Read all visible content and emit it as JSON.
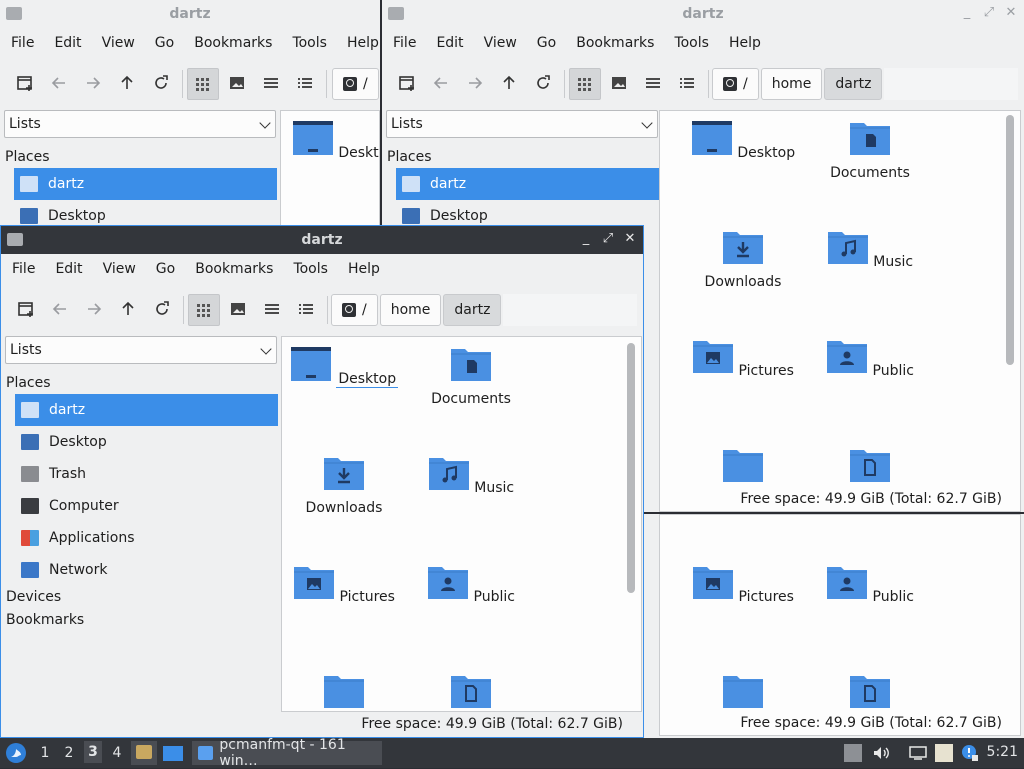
{
  "window": {
    "title": "dartz",
    "menu": [
      "File",
      "Edit",
      "View",
      "Go",
      "Bookmarks",
      "Tools",
      "Help"
    ],
    "side_mode": "Lists",
    "places_heading": "Places",
    "places": [
      {
        "label": "dartz",
        "icon": "home-folder-icon"
      },
      {
        "label": "Desktop",
        "icon": "desktop-icon"
      },
      {
        "label": "Trash",
        "icon": "trash-icon"
      },
      {
        "label": "Computer",
        "icon": "computer-icon"
      },
      {
        "label": "Applications",
        "icon": "applications-icon"
      },
      {
        "label": "Network",
        "icon": "network-icon"
      }
    ],
    "devices_heading": "Devices",
    "bookmarks_heading": "Bookmarks",
    "path": {
      "root": "/",
      "home": "home",
      "current": "dartz"
    },
    "files": [
      "Desktop",
      "Documents",
      "Downloads",
      "Music",
      "Pictures",
      "Public"
    ],
    "status": "Free space: 49.9 GiB (Total: 62.7 GiB)"
  },
  "taskbar": {
    "desktops": [
      "1",
      "2",
      "3",
      "4"
    ],
    "task_label": "pcmanfm-qt - 161 win…",
    "clock": "5:21"
  },
  "colors": {
    "accent": "#3b8ee8",
    "folder": "#4a90e2",
    "folder_dark": "#1f3a63",
    "titlebar": "#33363b"
  }
}
